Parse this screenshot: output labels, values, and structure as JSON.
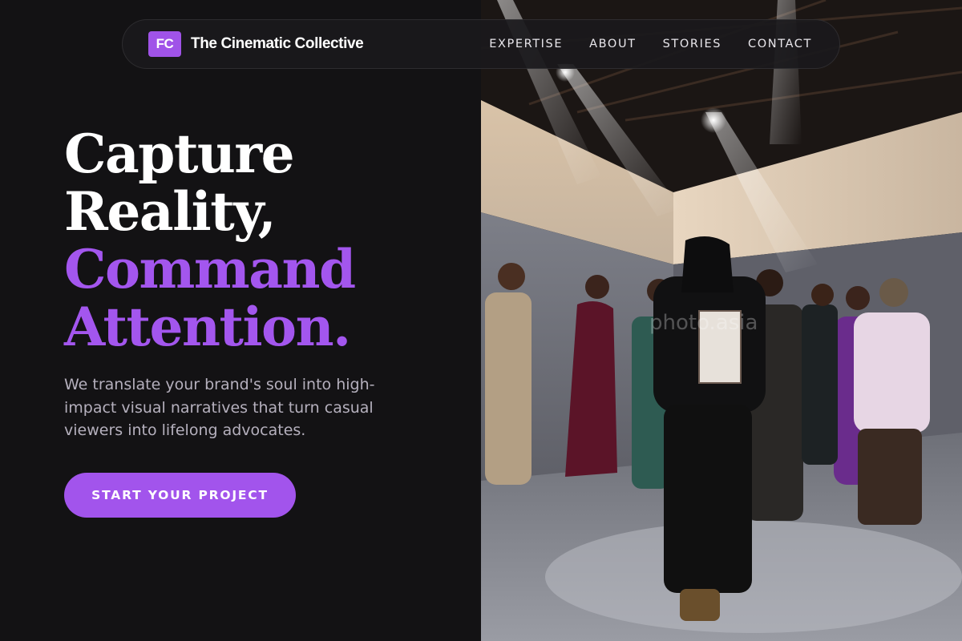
{
  "nav": {
    "logo_initials": "FC",
    "brand_name": "The Cinematic Collective",
    "links": [
      "EXPERTISE",
      "ABOUT",
      "STORIES",
      "CONTACT"
    ]
  },
  "hero": {
    "headline": [
      "Capture",
      "Reality,",
      "Command",
      "Attention."
    ],
    "subheadline": "We translate your brand's soul into high-impact visual narratives that turn casual viewers into lifelong advocates.",
    "cta_label": "START YOUR PROJECT"
  },
  "photo": {
    "watermark": "photo.asia"
  },
  "colors": {
    "background": "#131214",
    "accent": "#a254ec",
    "nav_bg": "#1a191c",
    "text_muted": "#b5b0bd"
  }
}
